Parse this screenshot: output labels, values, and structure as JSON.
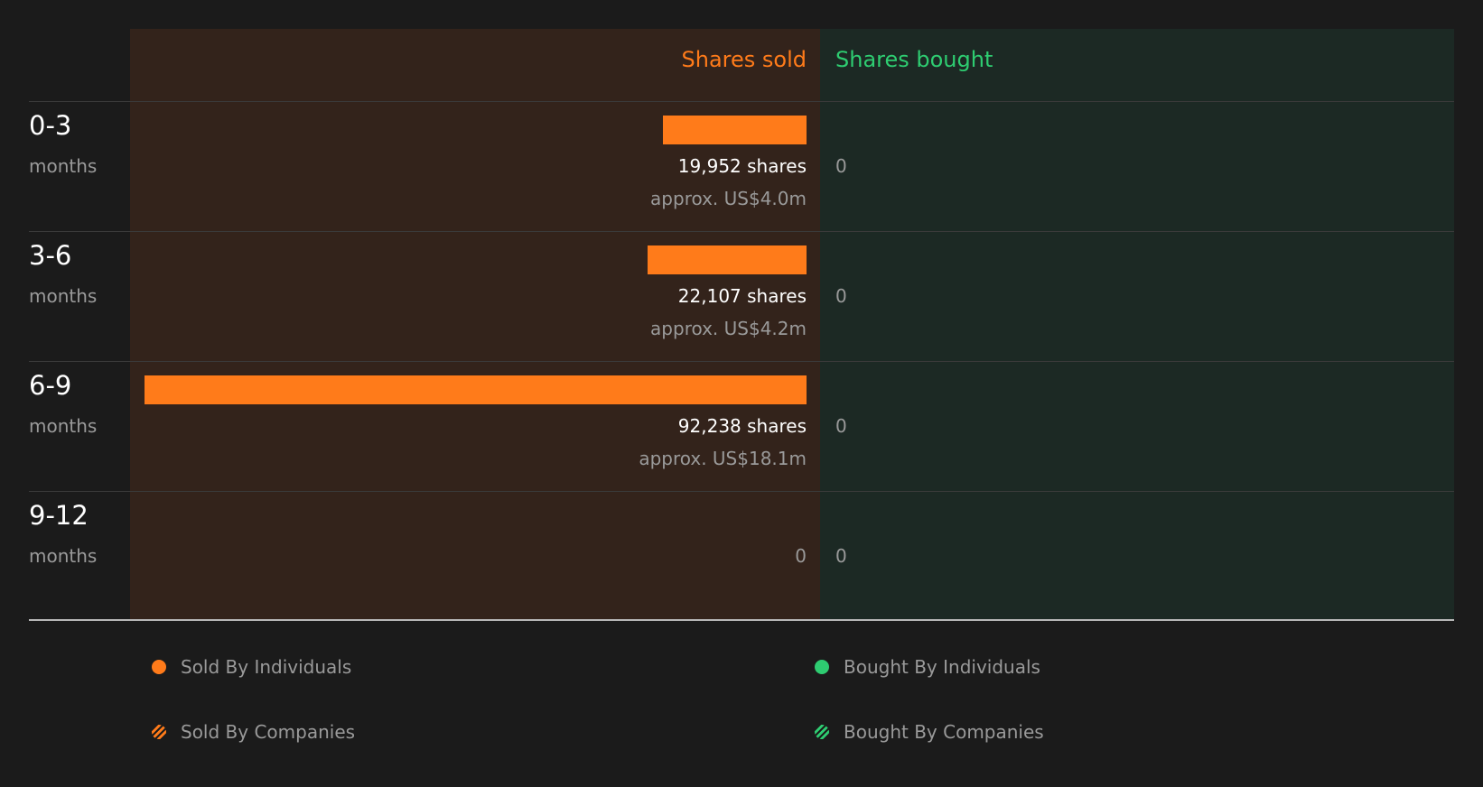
{
  "chart_data": {
    "type": "bar",
    "headers": {
      "sold": "Shares sold",
      "bought": "Shares bought"
    },
    "colors": {
      "sold": "#ff7b1a",
      "bought": "#2ecc71"
    },
    "rows": [
      {
        "period": "0-3",
        "unit": "months",
        "sold": 19952,
        "sold_label": "19,952 shares",
        "approx": "approx. US$4.0m",
        "bought": 0,
        "bought_label": "0"
      },
      {
        "period": "3-6",
        "unit": "months",
        "sold": 22107,
        "sold_label": "22,107 shares",
        "approx": "approx. US$4.2m",
        "bought": 0,
        "bought_label": "0"
      },
      {
        "period": "6-9",
        "unit": "months",
        "sold": 92238,
        "sold_label": "92,238 shares",
        "approx": "approx. US$18.1m",
        "bought": 0,
        "bought_label": "0"
      },
      {
        "period": "9-12",
        "unit": "months",
        "sold": 0,
        "sold_label": "0",
        "approx": "",
        "bought": 0,
        "bought_label": "0"
      }
    ],
    "legend": [
      {
        "label": "Sold By Individuals",
        "style": "dot-sold-ind"
      },
      {
        "label": "Bought By Individuals",
        "style": "dot-bought-ind"
      },
      {
        "label": "Sold By Companies",
        "style": "dot-sold-co"
      },
      {
        "label": "Bought By Companies",
        "style": "dot-bought-co"
      }
    ]
  }
}
